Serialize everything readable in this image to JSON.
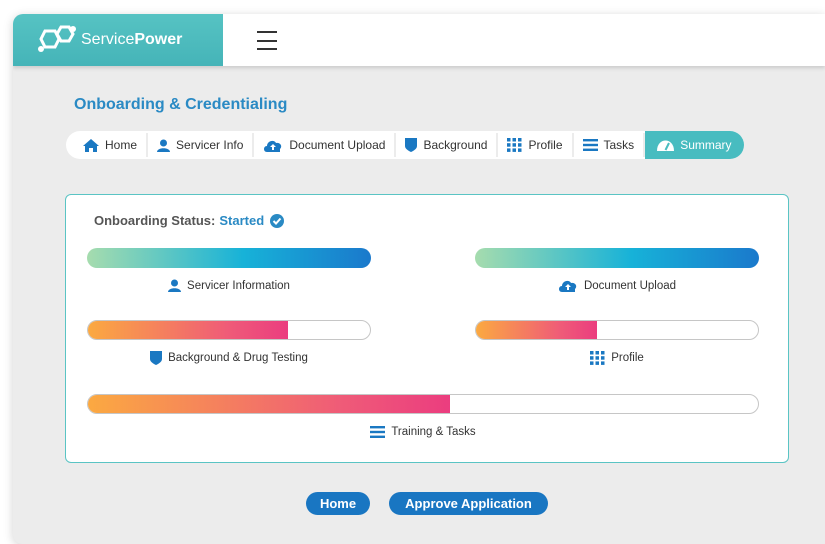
{
  "header": {
    "brand_prefix": "Service",
    "brand_suffix": "Power",
    "menu_icon": "hamburger-icon"
  },
  "page_title": "Onboarding & Credentialing",
  "tabs": [
    {
      "label": "Home",
      "icon": "home-icon"
    },
    {
      "label": "Servicer Info",
      "icon": "user-icon"
    },
    {
      "label": "Document Upload",
      "icon": "cloud-upload-icon"
    },
    {
      "label": "Background",
      "icon": "shield-icon"
    },
    {
      "label": "Profile",
      "icon": "grid-icon"
    },
    {
      "label": "Tasks",
      "icon": "list-icon"
    },
    {
      "label": "Summary",
      "icon": "gauge-icon",
      "active": true
    }
  ],
  "status": {
    "label": "Onboarding Status:",
    "value": "Started",
    "icon": "check-circle-icon"
  },
  "progress": [
    {
      "label": "Servicer Information",
      "percent": 100,
      "style": "blue",
      "icon": "user-icon"
    },
    {
      "label": "Document Upload",
      "percent": 100,
      "style": "blue",
      "icon": "cloud-upload-icon"
    },
    {
      "label": "Background & Drug Testing",
      "percent": 71,
      "style": "pink",
      "icon": "shield-icon"
    },
    {
      "label": "Profile",
      "percent": 43,
      "style": "pink",
      "icon": "grid-icon"
    },
    {
      "label": "Training & Tasks",
      "percent": 54,
      "style": "pink",
      "icon": "list-icon"
    }
  ],
  "buttons": {
    "home": "Home",
    "approve": "Approve Application"
  },
  "colors": {
    "brand_teal": "#48bcc0",
    "title_blue": "#2a8ac4",
    "button_blue": "#1976c2"
  }
}
